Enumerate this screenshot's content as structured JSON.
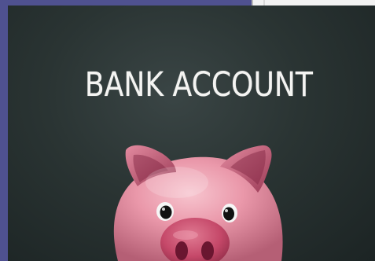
{
  "image": {
    "headline": "BANK ACCOUNT",
    "subject": "piggy-bank",
    "colors": {
      "frame": "#4f5190",
      "chalkboard": "#2a3433",
      "pig_body": "#e892a3",
      "pig_snout": "#c74d6b",
      "text": "#f4f4f2"
    }
  }
}
